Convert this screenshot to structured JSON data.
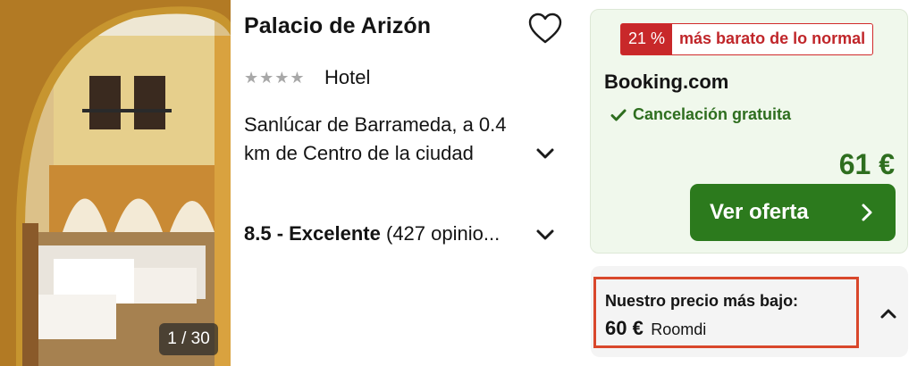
{
  "photo": {
    "counter": "1 / 30"
  },
  "hotel": {
    "name": "Palacio de Arizón",
    "stars": 4,
    "stars_text": "★★★★",
    "type": "Hotel",
    "location": "Sanlúcar de Barrameda, a 0.4 km de Centro de la ciudad",
    "rating_score": "8.5 - Excelente",
    "rating_count": " (427 opinio..."
  },
  "offer": {
    "deal_percent": "21 %",
    "deal_text": "más barato de lo normal",
    "provider": "Booking.com",
    "cancellation": "Cancelación gratuita",
    "price": "61 €",
    "cta_label": "Ver oferta"
  },
  "lowest": {
    "title": "Nuestro precio más bajo:",
    "price": "60 €",
    "provider": "Roomdi"
  },
  "colors": {
    "accent_green": "#2c7a1d",
    "deal_red": "#c8282a",
    "highlight_border": "#d9472b",
    "offer_bg": "#f0f8ec"
  },
  "icons": {
    "favorite": "heart-outline-icon",
    "expand_location": "chevron-down-icon",
    "expand_rating": "chevron-down-icon",
    "cancellation": "checkmark-icon",
    "cta": "chevron-right-icon",
    "collapse_lowest": "chevron-up-icon"
  }
}
